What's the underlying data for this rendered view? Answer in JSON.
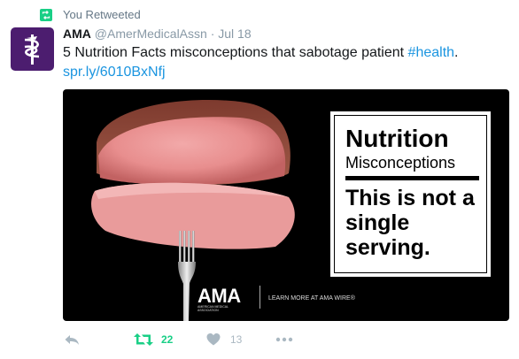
{
  "context": {
    "retweet_label": "You Retweeted"
  },
  "tweet": {
    "author_name": "AMA",
    "handle": "@AmerMedicalAssn",
    "separator": "·",
    "date": "Jul 18",
    "text_main": "5 Nutrition Facts misconceptions that sabotage patient ",
    "hashtag": "#health",
    "text_end": ".",
    "link": "spr.ly/6010BxNfj"
  },
  "media": {
    "headline": "Nutrition",
    "subheadline": "Misconceptions",
    "body": "This is not a single serving.",
    "logo": "AMA",
    "logo_subtitle": "AMERICAN MEDICAL ASSOCIATION",
    "cta": "LEARN MORE AT AMA WIRE®"
  },
  "actions": {
    "retweet_count": "22",
    "like_count": "13"
  },
  "colors": {
    "retweet_green": "#19cf86",
    "link_blue": "#1b95e0",
    "muted_gray": "#aab8c2",
    "avatar_purple": "#4c1d6f"
  },
  "icons": {
    "context": "retweet-icon",
    "reply": "reply-icon",
    "retweet": "retweet-icon",
    "like": "heart-icon",
    "more": "more-icon"
  }
}
